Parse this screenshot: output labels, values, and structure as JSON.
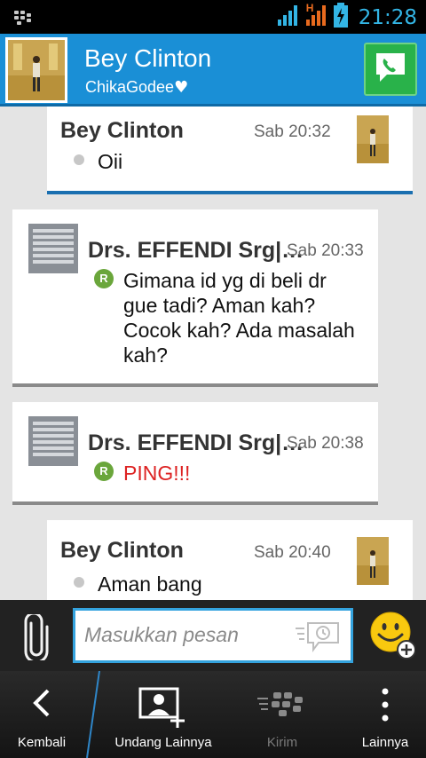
{
  "status_bar": {
    "time": "21:28",
    "network_type": "H"
  },
  "header": {
    "contact_name": "Bey Clinton",
    "contact_status": "ChikaGodee",
    "status_emoji": "♥"
  },
  "messages": [
    {
      "sender": "Bey Clinton",
      "time": "Sab 20:32",
      "text": "Oii"
    },
    {
      "sender": "Drs. EFFENDI Srg|…",
      "time": "Sab 20:33",
      "text_lines": [
        "Gimana id yg di beli dr",
        "gue tadi? Aman kah?",
        "Cocok kah? Ada masalah",
        "kah?"
      ],
      "read_badge": "R"
    },
    {
      "sender": "Drs. EFFENDI Srg|…",
      "time": "Sab 20:38",
      "text": "PING!!!",
      "read_badge": "R"
    },
    {
      "sender": "Bey Clinton",
      "time": "Sab 20:40",
      "text": "Aman bang"
    }
  ],
  "compose": {
    "placeholder": "Masukkan pesan"
  },
  "action_bar": {
    "back_label": "Kembali",
    "invite_label": "Undang Lainnya",
    "send_label": "Kirim",
    "more_label": "Lainnya"
  },
  "colors": {
    "header_bg": "#1a8fd6",
    "accent": "#33b5e5",
    "ping_text": "#dd2222",
    "call_button": "#29b24a"
  }
}
